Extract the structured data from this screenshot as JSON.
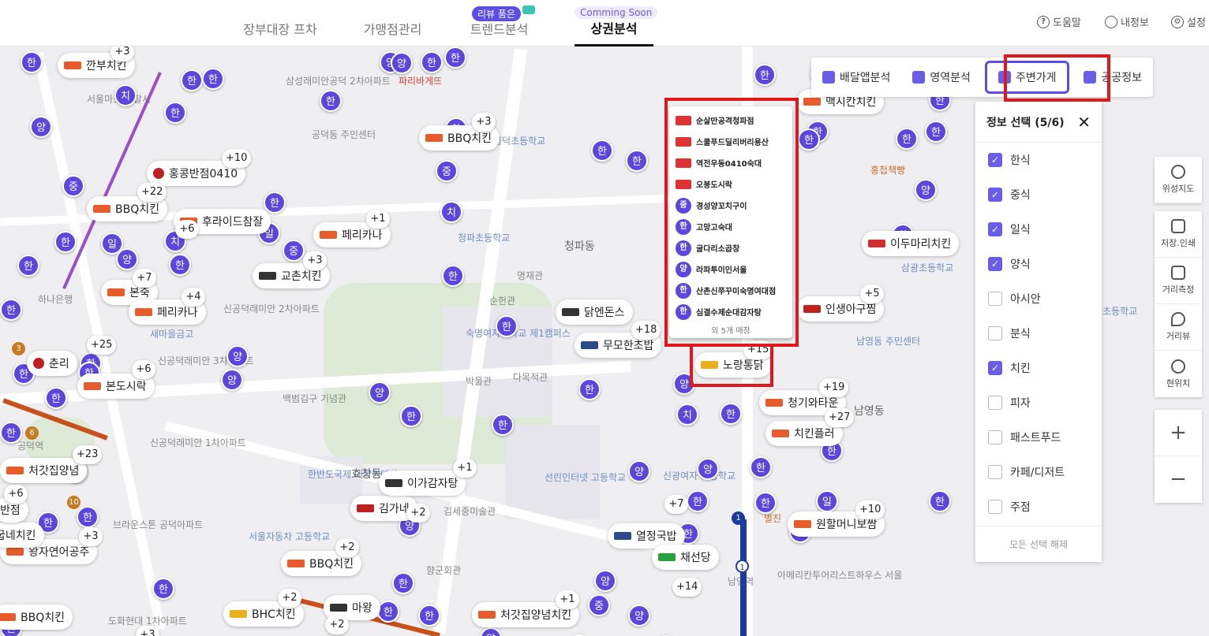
{
  "nav": {
    "tabs": [
      "장부대장 프차",
      "가맹점관리",
      "트렌드분석",
      "상권분석"
    ],
    "review_pill": "리뷰 품은",
    "soon_pill": "Comming Soon",
    "help": "도움말",
    "myinfo": "내정보",
    "settings": "설정"
  },
  "toolbar": {
    "delivery": "배달앱분석",
    "region": "영역분석",
    "nearby": "주변가게",
    "public": "공공정보"
  },
  "panel": {
    "title": "정보 선택 (5/6)",
    "options": [
      {
        "label": "한식",
        "checked": true
      },
      {
        "label": "중식",
        "checked": true
      },
      {
        "label": "일식",
        "checked": true
      },
      {
        "label": "양식",
        "checked": true
      },
      {
        "label": "아시안",
        "checked": false
      },
      {
        "label": "분식",
        "checked": false
      },
      {
        "label": "치킨",
        "checked": true
      },
      {
        "label": "피자",
        "checked": false
      },
      {
        "label": "패스트푸드",
        "checked": false
      },
      {
        "label": "카페/디저트",
        "checked": false
      },
      {
        "label": "주점",
        "checked": false
      }
    ],
    "clear": "모든 선택 해제"
  },
  "side": {
    "satellite": "위성지도",
    "print": "저장.인쇄",
    "distance": "거리측정",
    "street": "거리뷰",
    "location": "현위치",
    "zoom_in": "+",
    "zoom_out": "−"
  },
  "popup": {
    "items": [
      {
        "name": "순살만공격청파점",
        "badge": ""
      },
      {
        "name": "스쿨푸드딜리버리용산",
        "badge": ""
      },
      {
        "name": "역전우동0410숙대",
        "badge": ""
      },
      {
        "name": "오봉도시락",
        "badge": ""
      },
      {
        "name": "경성양꼬치구이",
        "badge": "중"
      },
      {
        "name": "고망고숙대",
        "badge": "한"
      },
      {
        "name": "굴다리소곱창",
        "badge": "한"
      },
      {
        "name": "라파투이인서울",
        "badge": "양"
      },
      {
        "name": "산촌신쭈꾸미숙명여대점",
        "badge": "한"
      },
      {
        "name": "심결수제순대감자탕",
        "badge": "한"
      }
    ],
    "more": "외 5개 매장"
  },
  "map_labels": [
    "삼성래미안공덕 2차아파트",
    "파리바게뜨",
    "공덕동 주민센터",
    "공덕초등학교",
    "청파초등학교",
    "청파동",
    "명재관",
    "순헌관",
    "숙명여자대학교 제1캠퍼스",
    "박물관",
    "다목적관",
    "백범김구 기념관",
    "신공덕래미안 2차아파트",
    "신공덕래미안 3차아파트",
    "신공덕래미안 1차아파트",
    "공덕역",
    "하나은행",
    "서울마포 경찰서",
    "새마을금고",
    "한반도국제 대학원대학교",
    "효창동",
    "서울자동차 고등학교",
    "향군회관",
    "김세중미술관",
    "선린인터넷 고등학교",
    "삼광초등학교",
    "남영동 주민센터",
    "남영동",
    "남영역",
    "아메리칸투어리스트하우스 서울",
    "삼광초등학교",
    "홍첩책빵",
    "신광여자 고등학교",
    "별진",
    "도화현대 1차아파트",
    "브라운스톤 공덕아파트",
    "청파동",
    "삼성래미안공덕 2차아파트"
  ],
  "bubbles": [
    "한",
    "양",
    "한",
    "한",
    "한",
    "한",
    "양",
    "치",
    "양",
    "한",
    "중",
    "한",
    "한",
    "일",
    "중",
    "한",
    "일",
    "치",
    "양",
    "한",
    "한",
    "양",
    "한",
    "한",
    "한",
    "한",
    "양",
    "한",
    "한",
    "한",
    "한",
    "한",
    "한",
    "일",
    "한",
    "치",
    "한",
    "한",
    "중",
    "한",
    "한",
    "한",
    "한",
    "양",
    "한",
    "한",
    "양",
    "한",
    "치",
    "양",
    "한",
    "한",
    "양",
    "한",
    "한",
    "한",
    "한",
    "일",
    "한",
    "양",
    "한",
    "한",
    "한",
    "한",
    "양",
    "한",
    "한",
    "양",
    "한",
    "한",
    "중",
    "양",
    "한",
    "양",
    "한",
    "한",
    "한",
    "한",
    "양"
  ],
  "cards": [
    {
      "name": "깐부치킨",
      "count": "+3"
    },
    {
      "name": "BBQ치킨",
      "count": "+3"
    },
    {
      "name": "홍콩반점0410",
      "count": "+10"
    },
    {
      "name": "BBQ치킨",
      "count": "+22"
    },
    {
      "name": "후라이드참잘",
      "count": "+6"
    },
    {
      "name": "페리카나",
      "count": "+1"
    },
    {
      "name": "교촌치킨",
      "count": "+3"
    },
    {
      "name": "본죽",
      "count": "+7"
    },
    {
      "name": "페리카나",
      "count": "+4"
    },
    {
      "name": "춘리",
      "count": "+25"
    },
    {
      "name": "본도시락",
      "count": "+6"
    },
    {
      "name": "처갓집양념",
      "count": "+23"
    },
    {
      "name": "닭엔돈스",
      "count": ""
    },
    {
      "name": "무모한초밥",
      "count": "+18"
    },
    {
      "name": "노랑통닭",
      "count": "+15"
    },
    {
      "name": "청기와타운",
      "count": "+19"
    },
    {
      "name": "치킨플러",
      "count": "+27"
    },
    {
      "name": "인생아구찜",
      "count": "+5"
    },
    {
      "name": "이두마리치킨",
      "count": ""
    },
    {
      "name": "맥시칸치킨",
      "count": ""
    },
    {
      "name": "김가네",
      "count": "+2"
    },
    {
      "name": "이가감자탕",
      "count": "+1"
    },
    {
      "name": "BBQ치킨",
      "count": "+2"
    },
    {
      "name": "BHC치킨",
      "count": "+2"
    },
    {
      "name": "마왕",
      "count": "+2"
    },
    {
      "name": "처갓집양념치킨",
      "count": "+1"
    },
    {
      "name": "열정국밥",
      "count": "+7"
    },
    {
      "name": "채선당",
      "count": "+14"
    },
    {
      "name": "원할머니보쌈",
      "count": "+10"
    },
    {
      "name": "왕자연어공주",
      "count": "+3"
    },
    {
      "name": "BBQ치킨",
      "count": "+3"
    },
    {
      "name": "굽네치킨",
      "count": ""
    },
    {
      "name": "반점",
      "count": "+6"
    }
  ]
}
